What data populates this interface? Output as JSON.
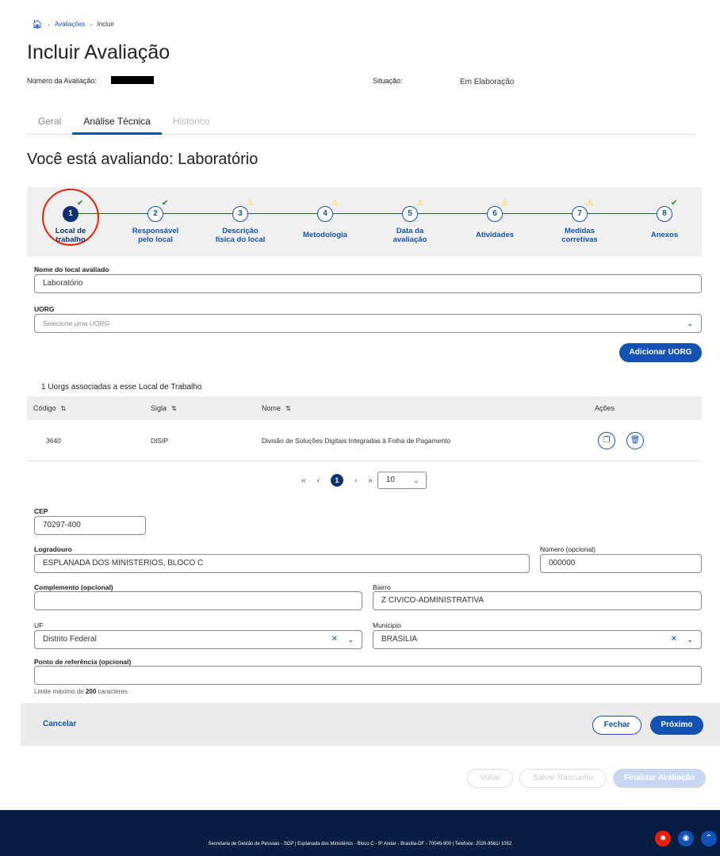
{
  "breadcrumb": {
    "items": [
      "Avaliações",
      "Incluir"
    ]
  },
  "page_title": "Incluir Avaliação",
  "meta": {
    "numero_label": "Número da Avaliação:",
    "situacao_label": "Situação:",
    "situacao_value": "Em Elaboração"
  },
  "tabs": [
    {
      "label": "Geral"
    },
    {
      "label": "Análise Técnica"
    },
    {
      "label": "Histórico"
    }
  ],
  "section_title": "Você está avaliando: Laboratório",
  "stepper": {
    "steps": [
      {
        "number": "1",
        "label_line1": "Local de",
        "label_line2": "trabalho",
        "status": "ok"
      },
      {
        "number": "2",
        "label_line1": "Responsável",
        "label_line2": "pelo local",
        "status": "ok"
      },
      {
        "number": "3",
        "label_line1": "Descrição",
        "label_line2": "física do local",
        "status": "warn"
      },
      {
        "number": "4",
        "label_line1": "Metodologia",
        "label_line2": "",
        "status": "warn"
      },
      {
        "number": "5",
        "label_line1": "Data da",
        "label_line2": "avaliação",
        "status": "warn"
      },
      {
        "number": "6",
        "label_line1": "Atividades",
        "label_line2": "",
        "status": "warn"
      },
      {
        "number": "7",
        "label_line1": "Medidas",
        "label_line2": "corretivas",
        "status": "warn"
      },
      {
        "number": "8",
        "label_line1": "Anexos",
        "label_line2": "",
        "status": "ok"
      }
    ],
    "ok_glyph": "✔",
    "warn_glyph": "⚠"
  },
  "form": {
    "nome_label": "Nome do local avaliado",
    "nome_value": "Laboratório",
    "uorg_label": "UORG",
    "uorg_placeholder": "Selecione uma UORG",
    "add_uorg_button": "Adicionar UORG",
    "cep_label": "CEP",
    "cep_value": "70297-400",
    "logradouro_label": "Logradouro",
    "logradouro_value": "ESPLANADA DOS MINISTERIOS, BLOCO C",
    "numero_label": "Número (opcional)",
    "numero_value": "000000",
    "complemento_label": "Complemento (opcional)",
    "complemento_value": "",
    "bairro_label": "Bairro",
    "bairro_value": "Z CIVICO-ADMINISTRATIVA",
    "uf_label": "UF",
    "uf_value": "Distrito Federal",
    "municipio_label": "Municipio",
    "municipio_value": "BRASILIA",
    "referencia_label": "Ponto de referência (opcional)",
    "referencia_value": "",
    "hint_prefix": "Limite máximo de",
    "hint_number": "200",
    "hint_suffix": "caracteres"
  },
  "table": {
    "caption": "1 Uorgs associadas a esse Local de Trabalho",
    "columns": [
      "Código",
      "Sigla",
      "Nome",
      "Ações"
    ],
    "rows": [
      {
        "codigo": "3640",
        "sigla": "DISIP",
        "nome": "Divisão de Soluções Digitais Integradas à Folha de Pagamento"
      }
    ]
  },
  "pagination": {
    "first": "«",
    "prev": "‹",
    "current": "1",
    "next": "›",
    "last": "»",
    "page_size": "10"
  },
  "actions": {
    "cancel": "Cancelar",
    "close": "Fechar",
    "next": "Próximo",
    "back": "Voltar",
    "save_draft": "Salvar Rascunho",
    "finalize": "Finalizar Avaliação"
  },
  "footer": {
    "text": "Secretaria de Gestão de Pessoas - SGP | Esplanada dos Ministérios - Bloco C - 9º Andar - Brasília-DF - 70046-900 | Telefone: 2020-8561/ 1052"
  },
  "colors": {
    "primary": "#1351b4",
    "dark_blue": "#0c326f",
    "footer_bg": "#071d41",
    "ok": "#168821",
    "warn": "#ffcd07",
    "highlight": "#e52207"
  }
}
